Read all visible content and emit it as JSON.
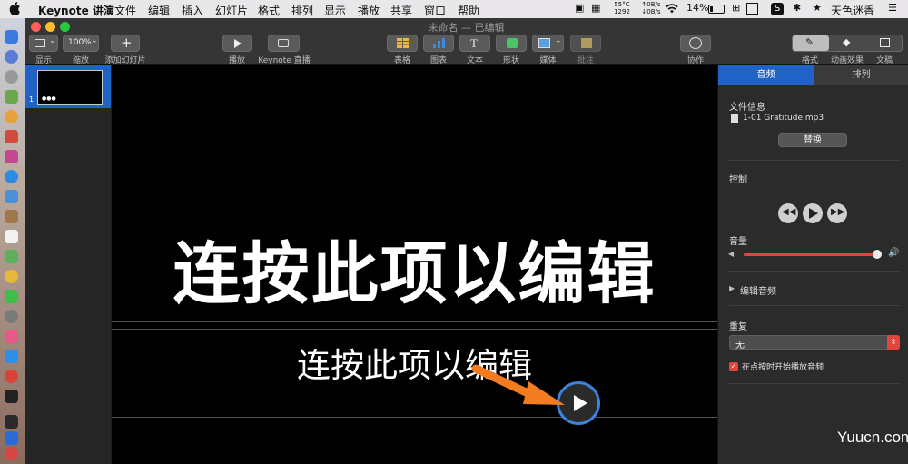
{
  "menubar": {
    "app_name": "Keynote 讲演",
    "items": [
      "文件",
      "编辑",
      "插入",
      "幻灯片",
      "格式",
      "排列",
      "显示",
      "播放",
      "共享",
      "窗口",
      "帮助"
    ],
    "temp": "55°C",
    "fan": "1292",
    "net_up": "0B/s",
    "net_down": "0B/s",
    "battery": "14%",
    "user": "天色迷香"
  },
  "window": {
    "title": "未命名 — 已编辑"
  },
  "toolbar": {
    "view_label": "显示",
    "zoom_value": "100%",
    "zoom_label": "缩放",
    "add_slide_label": "添加幻灯片",
    "play_label": "播放",
    "keynote_live_label": "Keynote 直播",
    "table_label": "表格",
    "chart_label": "图表",
    "text_label": "文本",
    "shape_label": "形状",
    "media_label": "媒体",
    "comment_label": "批注",
    "collaborate_label": "协作",
    "format_label": "格式",
    "animate_label": "动画效果",
    "document_label": "文稿"
  },
  "navigator": {
    "slide_number": "1",
    "thumb_dots": "●●●"
  },
  "slide": {
    "title": "连按此项以编辑",
    "subtitle": "连按此项以编辑"
  },
  "inspector": {
    "tab_audio": "音频",
    "tab_arrange": "排列",
    "file_info_label": "文件信息",
    "file_name": "1-01 Gratitude.mp3",
    "replace_label": "替换",
    "controls_label": "控制",
    "volume_label": "音量",
    "volume_level": 0.97,
    "edit_audio_label": "编辑音频",
    "repeat_label": "重复",
    "repeat_value": "无",
    "start_on_click_label": "在点按时开始播放音频",
    "start_on_click_checked": true
  },
  "watermark": "Yuucn.com",
  "colors": {
    "accent": "#1f63c7",
    "play_ring": "#3a84e0",
    "arrow": "#f47c20",
    "volume_fill": "#e0463c"
  }
}
